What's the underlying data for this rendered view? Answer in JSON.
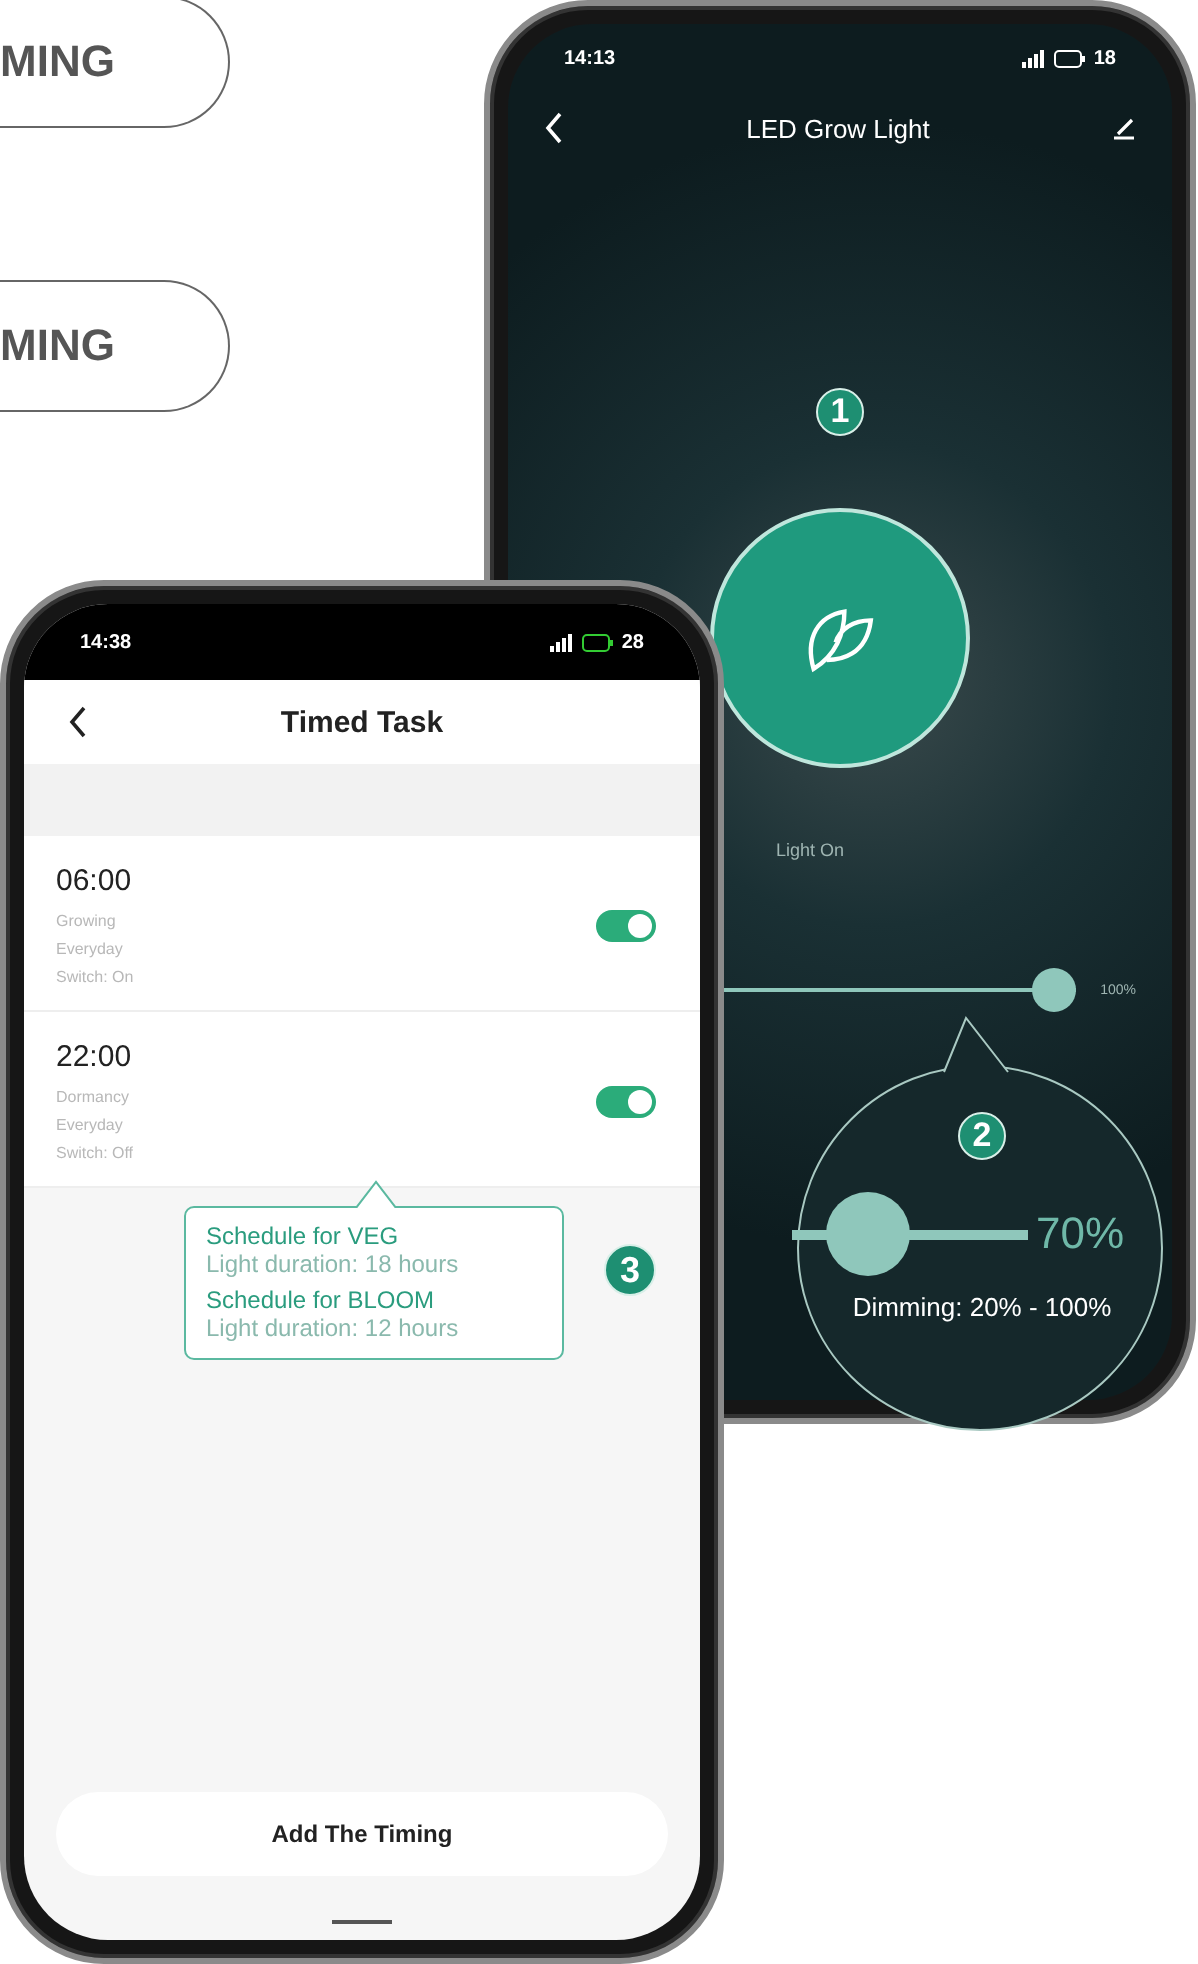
{
  "labels": [
    {
      "text": "MING"
    },
    {
      "text": "MING"
    }
  ],
  "light_phone": {
    "status_bar": {
      "time": "14:13",
      "battery": "18"
    },
    "title": "LED Grow Light",
    "badge": "1",
    "power": {
      "on": true,
      "label": "Light On"
    },
    "brightness": {
      "level": 1,
      "reading": "100%"
    },
    "zoom_callout": {
      "badge": "2",
      "slider": {
        "level": 0.32,
        "reading": "70%"
      },
      "caption": "Dimming: 20% - 100%"
    }
  },
  "timer_phone": {
    "status_bar": {
      "time": "14:38",
      "battery": "28"
    },
    "title": "Timed Task",
    "tasks": [
      {
        "time": "06:00",
        "mode": "Growing",
        "repeat": "Everyday",
        "action": "Switch: On",
        "on": true
      },
      {
        "time": "22:00",
        "mode": "Dormancy",
        "repeat": "Everyday",
        "action": "Switch: Off",
        "on": true
      }
    ],
    "callout": {
      "lines": [
        {
          "kind": "heading",
          "text": "Schedule for VEG"
        },
        {
          "kind": "detail",
          "text": "Light duration: 18 hours"
        },
        {
          "kind": "heading",
          "text": "Schedule for BLOOM"
        },
        {
          "kind": "detail",
          "text": "Light duration: 12 hours"
        }
      ],
      "badge": "3"
    },
    "add_button": "Add The Timing"
  }
}
